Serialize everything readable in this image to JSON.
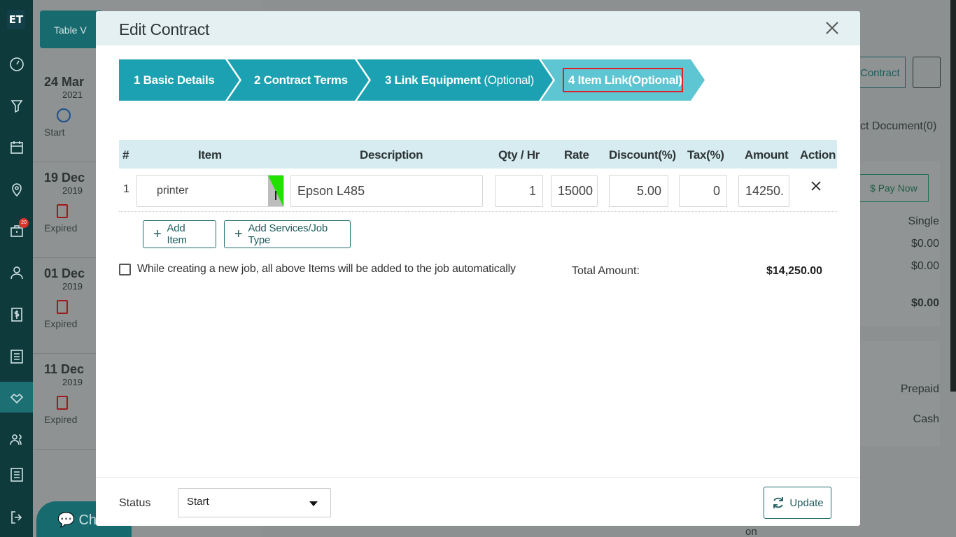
{
  "app": {
    "logo": "ET"
  },
  "rail": {
    "notification_count": "20"
  },
  "background": {
    "table_view_label": "Table V",
    "list": [
      {
        "day": "24 Mar",
        "year": "2021",
        "status": "Start"
      },
      {
        "day": "19 Dec",
        "year": "2019",
        "status": "Expired"
      },
      {
        "day": "01 Dec",
        "year": "2019",
        "status": "Expired"
      },
      {
        "day": "11 Dec",
        "year": "2019",
        "status": "Expired"
      }
    ],
    "chat_label": "Ch",
    "contract_button": "Contract",
    "document_tab": "ct Document(0)",
    "pay_now": "Pay Now",
    "values": [
      "Single",
      "$0.00",
      "$0.00",
      "$0.00"
    ],
    "prepaid": "Prepaid",
    "cash": "Cash",
    "on_text": "on"
  },
  "modal": {
    "title": "Edit Contract",
    "steps": [
      {
        "num": "1",
        "label": "Basic Details",
        "optional": ""
      },
      {
        "num": "2",
        "label": "Contract Terms",
        "optional": ""
      },
      {
        "num": "3",
        "label": "Link Equipment",
        "optional": "(Optional)"
      },
      {
        "num": "4",
        "label": "Item Link(Optional)",
        "optional": ""
      }
    ],
    "columns": {
      "num": "#",
      "item": "Item",
      "description": "Description",
      "qty": "Qty / Hr",
      "rate": "Rate",
      "discount": "Discount(%)",
      "tax": "Tax(%)",
      "amount": "Amount",
      "action": "Action"
    },
    "rows": [
      {
        "num": "1",
        "item": "printer",
        "description": "Epson L485",
        "qty": "1",
        "rate": "15000",
        "discount": "5.00",
        "tax": "0",
        "amount": "14250."
      }
    ],
    "add_item": "Add Item",
    "add_services": "Add Services/Job Type",
    "auto_add_label": "While creating a new job, all above Items will be added to the job automatically",
    "total_label": "Total Amount:",
    "total_value": "$14,250.00",
    "status_label": "Status",
    "status_value": "Start",
    "update_label": "Update"
  },
  "colors": {
    "teal": "#1ba1b1",
    "teal_light": "#5ec5d3",
    "accent": "#1f6d70",
    "highlight": "#e01f2a"
  }
}
